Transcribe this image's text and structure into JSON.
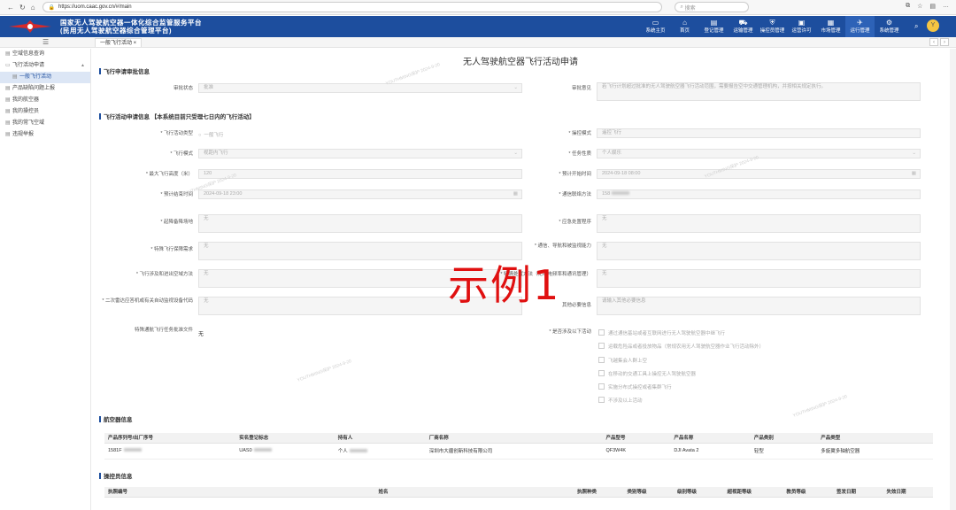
{
  "browser": {
    "url": "https://uom.caac.gov.cn/#/main",
    "search": "搜索"
  },
  "header": {
    "title_line1": "国家无人驾驶航空器一体化综合监管服务平台",
    "title_line2": "(民用无人驾驶航空器综合管理平台)",
    "menu": [
      {
        "label": "系统主页",
        "icon": "monitor-icon"
      },
      {
        "label": "首页",
        "icon": "home-icon"
      },
      {
        "label": "登记管理",
        "icon": "doc-icon"
      },
      {
        "label": "运输管理",
        "icon": "truck-icon"
      },
      {
        "label": "操控员管理",
        "icon": "shield-icon"
      },
      {
        "label": "运营许可",
        "icon": "certificate-icon"
      },
      {
        "label": "市场管理",
        "icon": "market-icon"
      },
      {
        "label": "运行管理",
        "icon": "plane-icon"
      },
      {
        "label": "系统管理",
        "icon": "settings-icon"
      }
    ],
    "avatar": "Y"
  },
  "tab": {
    "label": "一般飞行活动 ×"
  },
  "sidebar": {
    "items": [
      {
        "label": "空域信息查询"
      },
      {
        "label": "飞行活动申请"
      },
      {
        "label": "一般飞行活动"
      },
      {
        "label": "产品缺陷问题上报"
      },
      {
        "label": "我的航空器"
      },
      {
        "label": "我的操控员"
      },
      {
        "label": "我的常飞空域"
      },
      {
        "label": "违规举报"
      }
    ]
  },
  "page": {
    "title": "无人驾驶航空器飞行活动申请",
    "section_review": "飞行申请审批信息",
    "review_status_label": "审批状态",
    "review_status_value": "批准",
    "review_opinion_label": "审批意见",
    "review_opinion_value": "若飞行计划超过批准的无人驾驶航空器飞行活动范围，需要报告空中交通管理机构，并按相关规定执行。",
    "section_apply": "飞行活动申请信息 【本系统目前只受理七日内的飞行活动】",
    "fields": {
      "activity_type_label": "* 飞行活动类型",
      "activity_type_value": "一般飞行",
      "operate_mode_label": "* 操控模式",
      "operate_mode_value": "遥控飞行",
      "flight_mode_label": "* 飞行模式",
      "flight_mode_value": "视距内飞行",
      "task_nature_label": "* 任务性质",
      "task_nature_value": "个人娱乐",
      "max_height_label": "* 最大飞行高度（米）",
      "max_height_value": "120",
      "start_time_label": "* 预计开始时间",
      "start_time_value": "2024-09-18 08:00",
      "end_time_label": "* 预计结束时间",
      "end_time_value": "2024-09-18 23:00",
      "contact_label": "* 通信联络方法",
      "contact_value": "158",
      "takeoff_label": "* 起降备降场地",
      "takeoff_value": "无",
      "emergency_label": "* 应急处置程序",
      "emergency_value": "无",
      "security_label": "* 特殊飞行保障需求",
      "security_value": "无",
      "comm_nav_label": "* 通信、导航和被监视能力",
      "comm_nav_value": "无",
      "entry_exit_label": "* 飞行涉及和进出空域方法",
      "entry_exit_value": "无",
      "radio_label": "* 特情处置方法（无线电频率和通讯管理）",
      "radio_value": "无",
      "transponder_label": "* 二次雷达应答机或有关自动监视设备代码",
      "transponder_value": "无",
      "other_label": "其他必要信息",
      "other_value": "请输入其他必要信息",
      "special_file_label": "特殊通航飞行任务批准文件",
      "special_file_value": "无",
      "involve_label": "* 是否涉及以下活动",
      "involve_options": [
        "通过通信基站或者互联网进行无人驾驶航空器中继飞行",
        "运载危险品或者投放物品（常规农用无人驾驶航空器作业飞行活动除外）",
        "飞越集会人群上空",
        "在移动的交通工具上操控无人驾驶航空器",
        "实施分布式操控或者集群飞行",
        "不涉及以上活动"
      ]
    },
    "aircraft_section": "航空器信息",
    "aircraft_table": {
      "headers": [
        "产品序列号/出厂序号",
        "实名登记标志",
        "持有人",
        "厂商名称",
        "产品型号",
        "产品名称",
        "产品类别",
        "产品类型"
      ],
      "rows": [
        [
          "1581F",
          "UAS0",
          "个人",
          "深圳市大疆创新科技有限公司",
          "QF3W4K",
          "DJI Avata 2",
          "轻型",
          "多旋翼多轴航空器"
        ]
      ]
    },
    "operator_section": "操控员信息",
    "operator_table": {
      "headers": [
        "执照编号",
        "姓名",
        "执照种类",
        "类别等级",
        "级别等级",
        "超视距等级",
        "教员等级",
        "签发日期",
        "失效日期"
      ]
    },
    "overlay": "示例1",
    "watermark": "YOUTHMING保护 2024-9-20"
  }
}
